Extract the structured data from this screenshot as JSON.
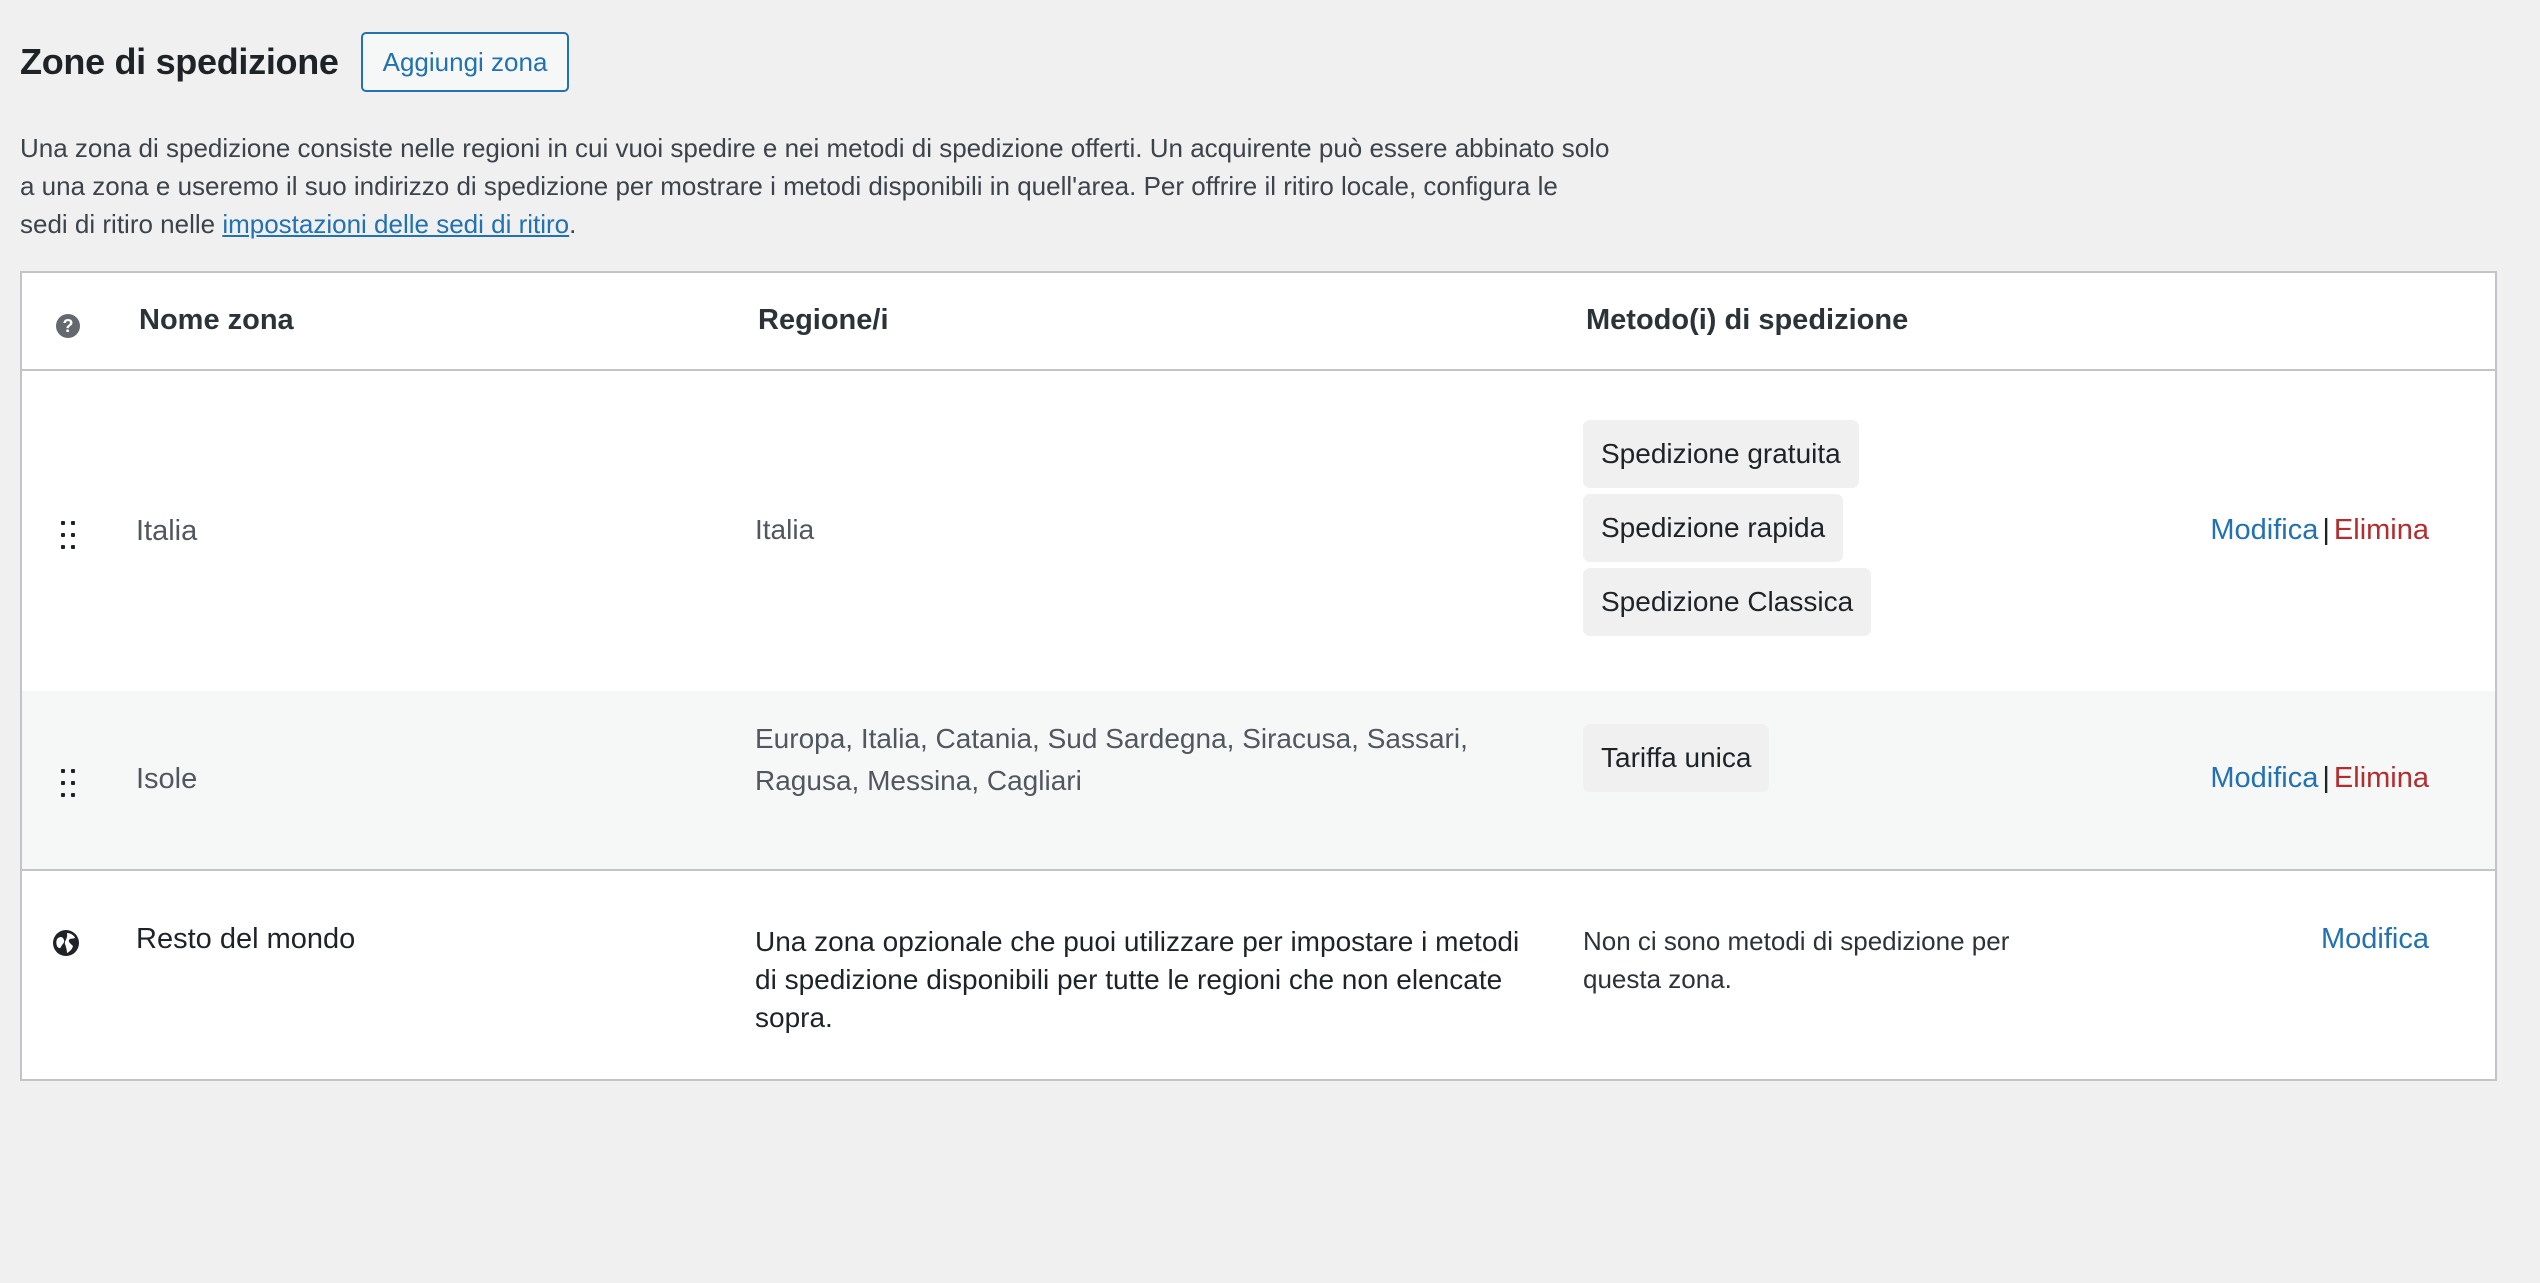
{
  "header": {
    "title": "Zone di spedizione",
    "add_button": "Aggiungi zona"
  },
  "description": {
    "text": "Una zona di spedizione consiste nelle regioni in cui vuoi spedire e nei metodi di spedizione offerti. Un acquirente può essere abbinato solo a una zona e useremo il suo indirizzo di spedizione per mostrare i metodi disponibili in quell'area. Per offrire il ritiro locale, configura le sedi di ritiro nelle ",
    "link": "impostazioni delle sedi di ritiro",
    "end": "."
  },
  "table": {
    "columns": {
      "help_icon": "?",
      "name": "Nome zona",
      "regions": "Regione/i",
      "methods": "Metodo(i) di spedizione"
    },
    "rows": [
      {
        "name": "Italia",
        "regions": "Italia",
        "methods": [
          "Spedizione gratuita",
          "Spedizione rapida",
          "Spedizione Classica"
        ],
        "edit": "Modifica",
        "separator": "|",
        "delete": "Elimina"
      },
      {
        "name": "Isole",
        "regions": "Europa, Italia, Catania, Sud Sardegna, Siracusa, Sassari, Ragusa, Messina, Cagliari",
        "methods": [
          "Tariffa unica"
        ],
        "edit": "Modifica",
        "separator": "|",
        "delete": "Elimina"
      }
    ],
    "rest_of_world": {
      "name": "Resto del mondo",
      "description": "Una zona opzionale che puoi utilizzare per impostare i metodi di spedizione disponibili per tutte le regioni che non elencate sopra.",
      "no_methods": "Non ci sono metodi di spedizione per questa zona.",
      "edit": "Modifica"
    }
  },
  "colors": {
    "background": "#f0f0f1",
    "link": "#2271b1",
    "delete": "#b32d2e",
    "border": "#c3c4c7"
  }
}
